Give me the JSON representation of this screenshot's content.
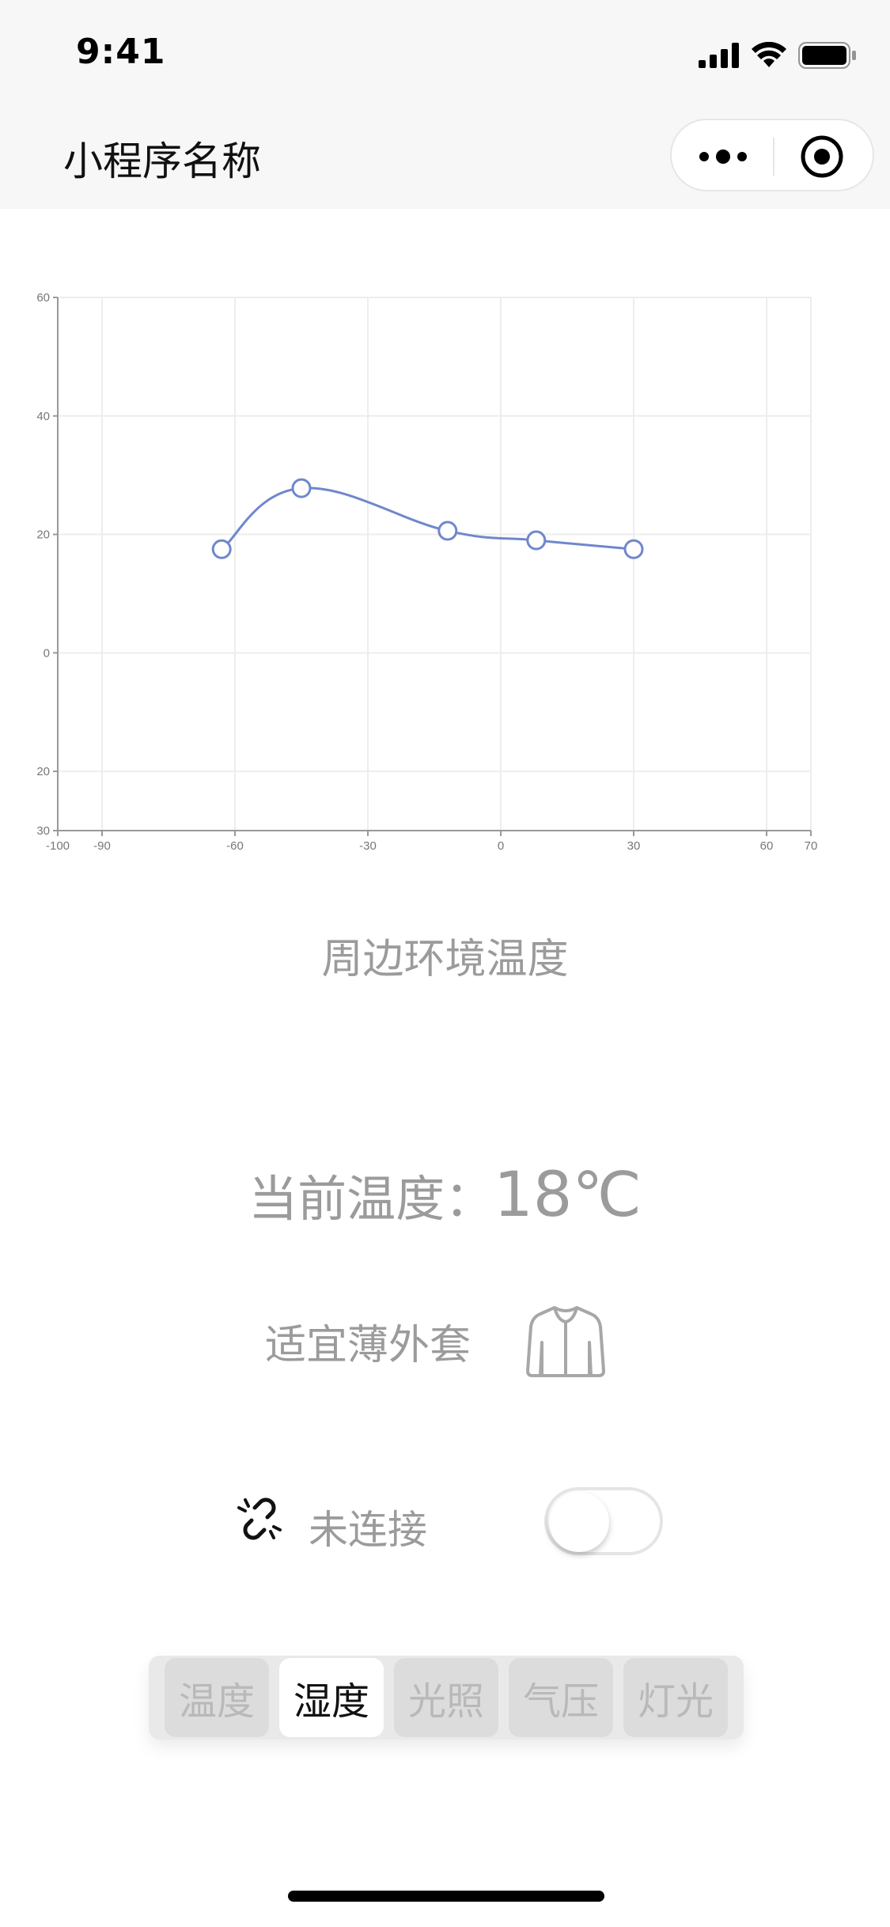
{
  "status_bar": {
    "time": "9:41"
  },
  "nav": {
    "title": "小程序名称"
  },
  "chart_data": {
    "type": "line",
    "x": [
      -63,
      -45,
      -12,
      8,
      30
    ],
    "y": [
      17.5,
      27.8,
      20.6,
      19.0,
      17.5
    ],
    "x_ticks": [
      -100,
      -90,
      -60,
      -30,
      0,
      30,
      60,
      70
    ],
    "y_ticks": [
      60,
      40,
      20,
      0,
      20,
      30
    ],
    "xlim": [
      -100,
      70
    ],
    "ylim": [
      -30,
      60
    ],
    "grid": true,
    "smooth": true,
    "color": "#6f87cc"
  },
  "caption": "周边环境温度",
  "current": {
    "label": "当前温度：",
    "value": "18℃"
  },
  "advice": {
    "text": "适宜薄外套"
  },
  "connection": {
    "status": "未连接"
  },
  "tabs": [
    {
      "label": "温度",
      "active": false
    },
    {
      "label": "湿度",
      "active": true
    },
    {
      "label": "光照",
      "active": false
    },
    {
      "label": "气压",
      "active": false
    },
    {
      "label": "灯光",
      "active": false
    }
  ]
}
